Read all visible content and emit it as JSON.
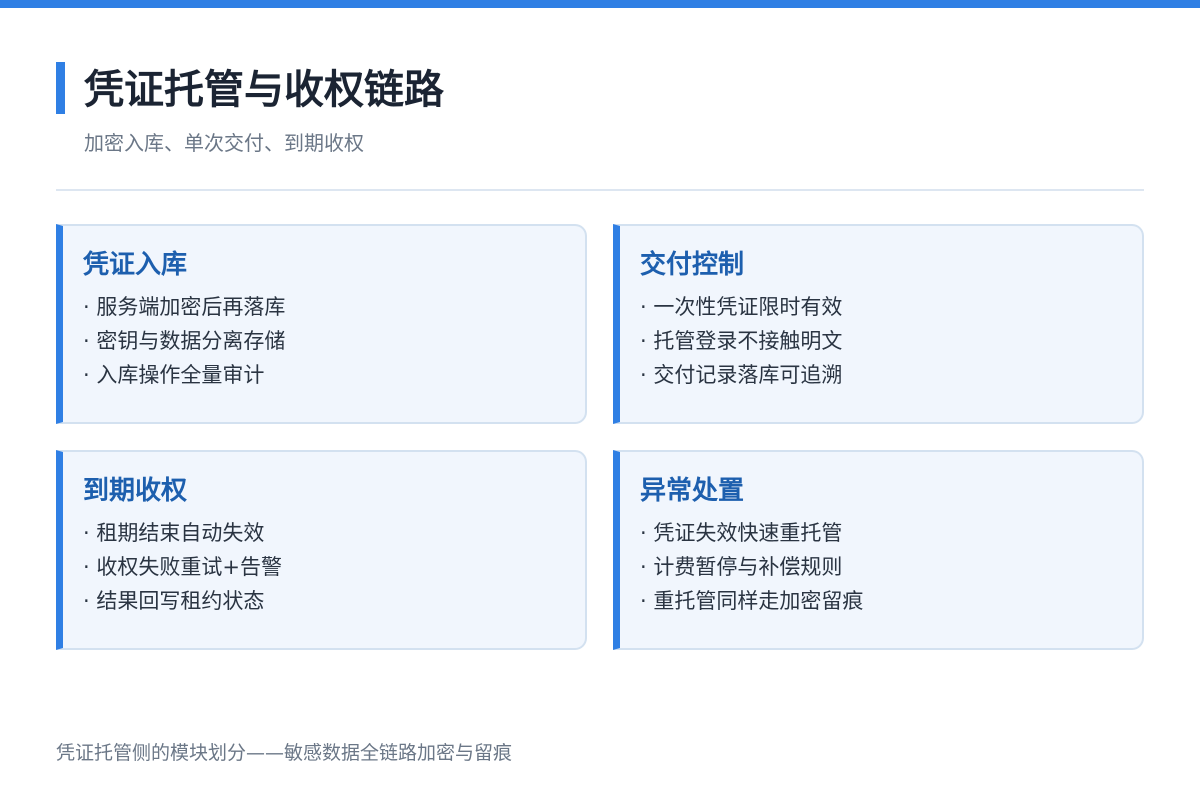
{
  "header": {
    "title": "凭证托管与收权链路",
    "subtitle": "加密入库、单次交付、到期收权"
  },
  "cards": [
    {
      "title": "凭证入库",
      "items": [
        "· 服务端加密后再落库",
        "· 密钥与数据分离存储",
        "· 入库操作全量审计"
      ]
    },
    {
      "title": "交付控制",
      "items": [
        "· 一次性凭证限时有效",
        "· 托管登录不接触明文",
        "· 交付记录落库可追溯"
      ]
    },
    {
      "title": "到期收权",
      "items": [
        "· 租期结束自动失效",
        "· 收权失败重试+告警",
        "· 结果回写租约状态"
      ]
    },
    {
      "title": "异常处置",
      "items": [
        "· 凭证失效快速重托管",
        "· 计费暂停与补偿规则",
        "· 重托管同样走加密留痕"
      ]
    }
  ],
  "footer": {
    "note": "凭证托管侧的模块划分——敏感数据全链路加密与留痕"
  },
  "colors": {
    "accent": "#2f7fe4",
    "card_title": "#1d5fae",
    "card_background": "#f1f6fd"
  }
}
